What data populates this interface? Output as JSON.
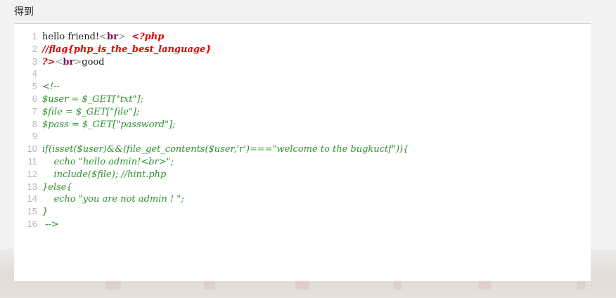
{
  "heading": "得到",
  "code": {
    "lines": [
      [
        {
          "t": "txt",
          "s": "hello friend!"
        },
        {
          "t": "tag",
          "s": "<"
        },
        {
          "t": "tagname",
          "s": "br"
        },
        {
          "t": "tag",
          "s": ">"
        },
        {
          "t": "txt",
          "s": "  "
        },
        {
          "t": "php",
          "s": "<?php"
        }
      ],
      [
        {
          "t": "php",
          "s": "//flag{php_is_the_best_language}"
        }
      ],
      [
        {
          "t": "php",
          "s": "?>"
        },
        {
          "t": "tag",
          "s": "<"
        },
        {
          "t": "tagname",
          "s": "br"
        },
        {
          "t": "tag",
          "s": ">"
        },
        {
          "t": "txt",
          "s": "good"
        }
      ],
      [],
      [
        {
          "t": "cmt",
          "s": "<!--"
        }
      ],
      [
        {
          "t": "cmt",
          "s": "$user = $_GET[\"txt\"];"
        }
      ],
      [
        {
          "t": "cmt",
          "s": "$file = $_GET[\"file\"];"
        }
      ],
      [
        {
          "t": "cmt",
          "s": "$pass = $_GET[\"password\"];"
        }
      ],
      [],
      [
        {
          "t": "cmt",
          "s": "if(isset($user)&&(file_get_contents($user,'r')===\"welcome to the bugkuctf\")){"
        }
      ],
      [
        {
          "t": "cmt",
          "s": "    echo \"hello admin!<br>\";"
        }
      ],
      [
        {
          "t": "cmt",
          "s": "    include($file); //hint.php"
        }
      ],
      [
        {
          "t": "cmt",
          "s": "}else{"
        }
      ],
      [
        {
          "t": "cmt",
          "s": "    echo \"you are not admin ! \";"
        }
      ],
      [
        {
          "t": "cmt",
          "s": "}"
        }
      ],
      [
        {
          "t": "cmt",
          "s": " -->"
        }
      ]
    ]
  }
}
